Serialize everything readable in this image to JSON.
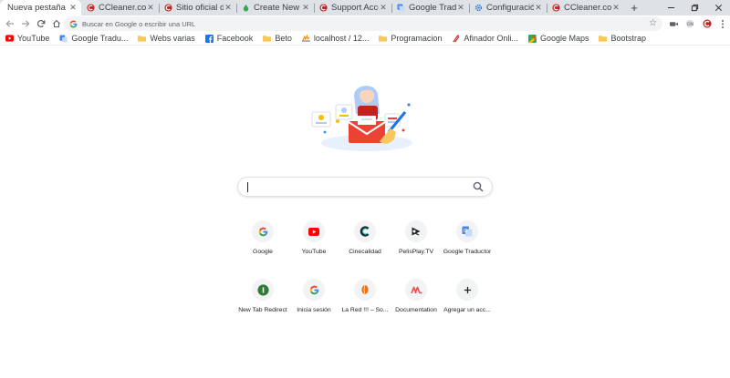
{
  "tabs": [
    {
      "title": "Nueva pestaña",
      "icon": "none",
      "active": true
    },
    {
      "title": "CCleaner.com",
      "icon": "ccleaner-icon"
    },
    {
      "title": "Sitio oficial d",
      "icon": "ccleaner-icon"
    },
    {
      "title": "Create New Ta",
      "icon": "create-icon"
    },
    {
      "title": "Support Acco",
      "icon": "ccleaner-icon"
    },
    {
      "title": "Google Tradu",
      "icon": "google-translate-icon"
    },
    {
      "title": "Configuración",
      "icon": "settings-icon"
    },
    {
      "title": "CCleaner.com",
      "icon": "ccleaner-icon"
    }
  ],
  "omnibox": {
    "placeholder": "Buscar en Google o escribir una URL"
  },
  "bookmarks": [
    {
      "label": "YouTube",
      "icon": "youtube-icon"
    },
    {
      "label": "Google Tradu...",
      "icon": "google-translate-icon"
    },
    {
      "label": "Webs varias",
      "icon": "folder-icon"
    },
    {
      "label": "Facebook",
      "icon": "facebook-icon"
    },
    {
      "label": "Beto",
      "icon": "folder-icon"
    },
    {
      "label": "localhost / 12...",
      "icon": "phpmyadmin-icon"
    },
    {
      "label": "Programacion",
      "icon": "folder-icon"
    },
    {
      "label": "Afinador Onli...",
      "icon": "tuner-icon"
    },
    {
      "label": "Google Maps",
      "icon": "maps-icon"
    },
    {
      "label": "Bootstrap",
      "icon": "folder-icon"
    }
  ],
  "shortcuts": [
    {
      "label": "Google",
      "icon": "google-icon"
    },
    {
      "label": "YouTube",
      "icon": "youtube-icon"
    },
    {
      "label": "Cinecalidad",
      "icon": "cinecalidad-icon"
    },
    {
      "label": "PelisPlay.TV",
      "icon": "pelisplay-icon"
    },
    {
      "label": "Google Traductor",
      "icon": "google-translate-icon"
    },
    {
      "label": "New Tab Redirect",
      "icon": "new-tab-redirect-icon"
    },
    {
      "label": "Inicia sesión",
      "icon": "google-icon"
    },
    {
      "label": "La Red !!! – So...",
      "icon": "la-red-icon"
    },
    {
      "label": "Documentation",
      "icon": "documentation-icon"
    },
    {
      "label": "Agregar un acc...",
      "icon": "add-icon"
    }
  ],
  "colors": {
    "tabstrip": "#dee1e6",
    "omnibox": "#f1f3f4",
    "ccleaner_red": "#c5221f",
    "youtube_red": "#ff0000",
    "google_blue": "#4285f4",
    "folder_yellow": "#f6c85f"
  }
}
